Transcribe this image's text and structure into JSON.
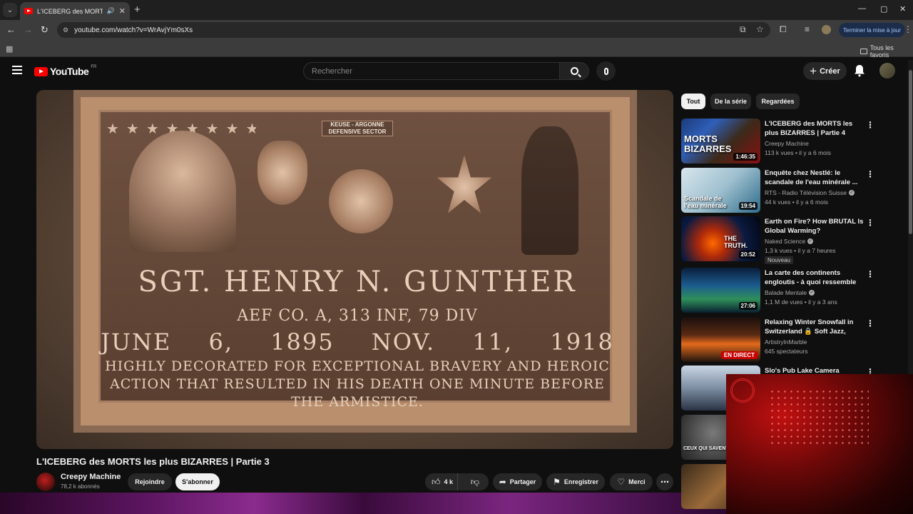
{
  "browser": {
    "tab_title": "L'ICEBERG des MORTS les p",
    "url": "youtube.com/watch?v=WrAvjYm0sXs",
    "update_button": "Terminer la mise à jour",
    "all_favorites": "Tous les favoris"
  },
  "header": {
    "logo_text": "YouTube",
    "country_code": "FR",
    "search_placeholder": "Rechercher",
    "create_label": "Créer"
  },
  "video": {
    "plaque": {
      "banner": "KEUSE - ARGONNE DEFENSIVE SECTOR",
      "name": "SGT. HENRY N. GUNTHER",
      "unit": "AEF CO. A, 313 INF, 79 DIV",
      "dates": "JUNE 6, 1895 NOV. 11, 1918",
      "line1": "HIGHLY DECORATED FOR EXCEPTIONAL BRAVERY AND HEROIC",
      "line2": "ACTION THAT RESULTED IN HIS DEATH ONE MINUTE BEFORE",
      "line3": "THE ARMISTICE."
    },
    "title": "L'ICEBERG des MORTS les plus BIZARRES | Partie 3",
    "channel_name": "Creepy Machine",
    "subscribers": "78,2 k abonnés",
    "join_label": "Rejoindre",
    "subscribe_label": "S'abonner",
    "likes": "4 k",
    "share_label": "Partager",
    "save_label": "Enregistrer",
    "thanks_label": "Merci"
  },
  "sidebar": {
    "chips": [
      "Tout",
      "De la série",
      "Regardées"
    ],
    "items": [
      {
        "title": "L'ICEBERG des MORTS les plus BIZARRES | Partie 4",
        "channel": "Creepy Machine",
        "meta": "113 k vues • il y a 6 mois",
        "duration": "1:46:35",
        "thumb_text": "MORTS BIZARRES"
      },
      {
        "title": "Enquête chez Nestlé: le scandale de l'eau minérale ...",
        "channel": "RTS - Radio Télévision Suisse",
        "meta": "44 k vues • il y a 6 mois",
        "duration": "19:54",
        "thumb_text": "Scandale de l'eau minérale"
      },
      {
        "title": "Earth on Fire? How BRUTAL Is Global Warming?",
        "channel": "Naked Science",
        "meta": "1,3 k vues • il y a 7 heures",
        "duration": "20:52",
        "badge": "Nouveau",
        "thumb_text": "THE TRUTH."
      },
      {
        "title": "La carte des continents engloutis - à quoi ressemble la...",
        "channel": "Balade Mentale",
        "meta": "1,1 M de vues • il y a 3 ans",
        "duration": "27:06"
      },
      {
        "title": "Relaxing Winter Snowfall in Switzerland 🔒 Soft Jazz, Coz...",
        "channel": "ArtistryInMarble",
        "meta": "645 spectateurs",
        "live": "EN DIRECT"
      },
      {
        "title": "Slo's Pub Lake Camera",
        "channel": "",
        "meta": ""
      },
      {
        "thumb_text": "CEUX QUI SAVENT"
      },
      {}
    ]
  }
}
